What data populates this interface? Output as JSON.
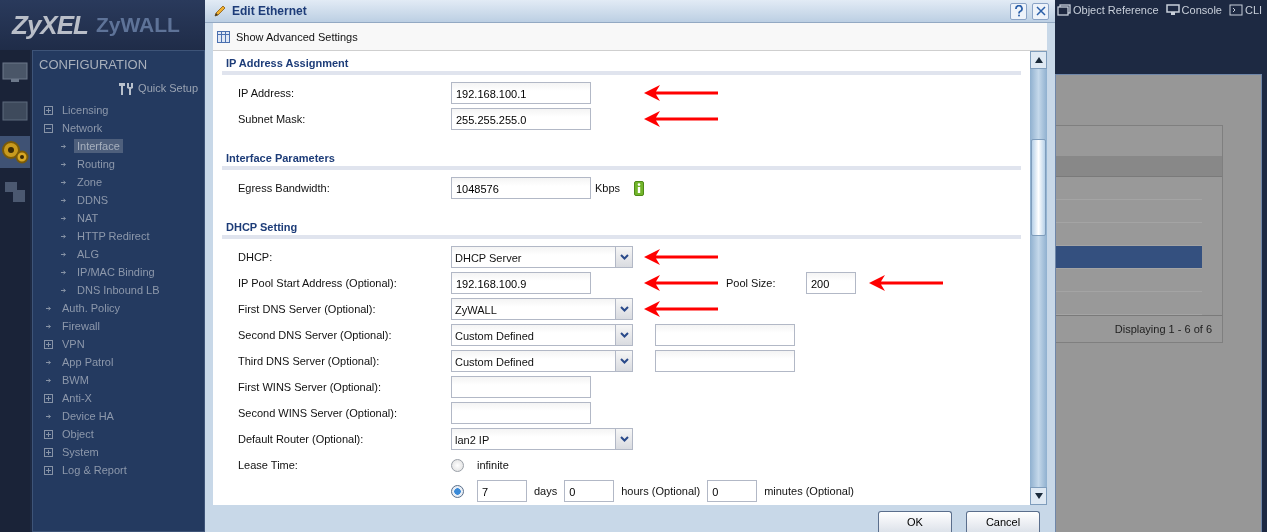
{
  "header": {
    "logo_brand": "ZyXEL",
    "logo_product": "ZyWALL",
    "links": [
      {
        "kind": "reference",
        "label": "Object Reference"
      },
      {
        "kind": "console",
        "label": "Console"
      },
      {
        "kind": "cli",
        "label": "CLI"
      }
    ]
  },
  "rail": [
    {
      "kind": "screen",
      "selected": false
    },
    {
      "kind": "monitor",
      "selected": false
    },
    {
      "kind": "config",
      "selected": true
    },
    {
      "kind": "maintenance",
      "selected": false
    }
  ],
  "sidebar": {
    "title": "CONFIGURATION",
    "quick_setup": "Quick Setup",
    "items": [
      {
        "label": "Licensing",
        "kind": "group",
        "expanded": false,
        "selected": false
      },
      {
        "label": "Network",
        "kind": "group",
        "expanded": true,
        "selected": false,
        "children": [
          {
            "label": "Interface",
            "selected": true
          },
          {
            "label": "Routing",
            "selected": false
          },
          {
            "label": "Zone",
            "selected": false
          },
          {
            "label": "DDNS",
            "selected": false
          },
          {
            "label": "NAT",
            "selected": false
          },
          {
            "label": "HTTP Redirect",
            "selected": false
          },
          {
            "label": "ALG",
            "selected": false
          },
          {
            "label": "IP/MAC Binding",
            "selected": false
          },
          {
            "label": "DNS Inbound LB",
            "selected": false
          }
        ]
      },
      {
        "label": "Auth. Policy",
        "kind": "link",
        "selected": false
      },
      {
        "label": "Firewall",
        "kind": "link",
        "selected": false
      },
      {
        "label": "VPN",
        "kind": "group",
        "expanded": false,
        "selected": false
      },
      {
        "label": "App Patrol",
        "kind": "link",
        "selected": false
      },
      {
        "label": "BWM",
        "kind": "link",
        "selected": false
      },
      {
        "label": "Anti-X",
        "kind": "group",
        "expanded": false,
        "selected": false
      },
      {
        "label": "Device HA",
        "kind": "link",
        "selected": false
      },
      {
        "label": "Object",
        "kind": "group",
        "expanded": false,
        "selected": false
      },
      {
        "label": "System",
        "kind": "group",
        "expanded": false,
        "selected": false
      },
      {
        "label": "Log & Report",
        "kind": "group",
        "expanded": false,
        "selected": false
      }
    ]
  },
  "dialog": {
    "title": "Edit Ethernet",
    "toolbar": "Show Advanced Settings",
    "sections": [
      {
        "title": "IP Address Assignment",
        "rows": [
          {
            "label": "IP Address:",
            "kind": "text",
            "value": "192.168.100.1",
            "arrow": true
          },
          {
            "label": "Subnet Mask:",
            "kind": "text",
            "value": "255.255.255.0",
            "arrow": true
          }
        ]
      },
      {
        "title": "Interface Parameters",
        "rows": [
          {
            "label": "Egress Bandwidth:",
            "kind": "text",
            "value": "1048576",
            "unit": "Kbps",
            "info": true
          }
        ]
      },
      {
        "title": "DHCP Setting",
        "rows": [
          {
            "label": "DHCP:",
            "kind": "select",
            "value": "DHCP Server",
            "arrow": true
          },
          {
            "label": "IP Pool Start Address (Optional):",
            "kind": "text",
            "value": "192.168.100.9",
            "arrow": true,
            "extra": {
              "label": "Pool Size:",
              "value": "200",
              "arrow": true
            }
          },
          {
            "label": "First DNS Server (Optional):",
            "kind": "select",
            "value": "ZyWALL",
            "arrow": true
          },
          {
            "label": "Second DNS Server (Optional):",
            "kind": "select",
            "value": "Custom Defined",
            "with_field": true
          },
          {
            "label": "Third DNS Server (Optional):",
            "kind": "select",
            "value": "Custom Defined",
            "with_field": true
          },
          {
            "label": "First WINS Server (Optional):",
            "kind": "text"
          },
          {
            "label": "Second WINS Server (Optional):",
            "kind": "text"
          },
          {
            "label": "Default Router (Optional):",
            "kind": "select",
            "value": "lan2 IP"
          },
          {
            "label": "Lease Time:",
            "kind": "radios",
            "options": [
              {
                "selected": false,
                "parts": [
                  {
                    "kind": "label",
                    "text": "infinite"
                  }
                ]
              },
              {
                "selected": true,
                "parts": [
                  {
                    "kind": "field",
                    "value": "7"
                  },
                  {
                    "kind": "label",
                    "text": "days"
                  },
                  {
                    "kind": "field",
                    "value": "0"
                  },
                  {
                    "kind": "label",
                    "text": "hours (Optional)"
                  },
                  {
                    "kind": "field",
                    "value": "0"
                  },
                  {
                    "kind": "label",
                    "text": "minutes (Optional)"
                  }
                ]
              }
            ]
          }
        ]
      }
    ],
    "buttons": [
      {
        "label": "OK"
      },
      {
        "label": "Cancel"
      }
    ]
  },
  "background_grid": {
    "rows": [
      {
        "selected": false
      },
      {
        "selected": false
      },
      {
        "selected": false
      },
      {
        "selected": true
      },
      {
        "selected": false
      },
      {
        "selected": false
      }
    ],
    "footer": "Displaying 1 - 6 of 6"
  }
}
